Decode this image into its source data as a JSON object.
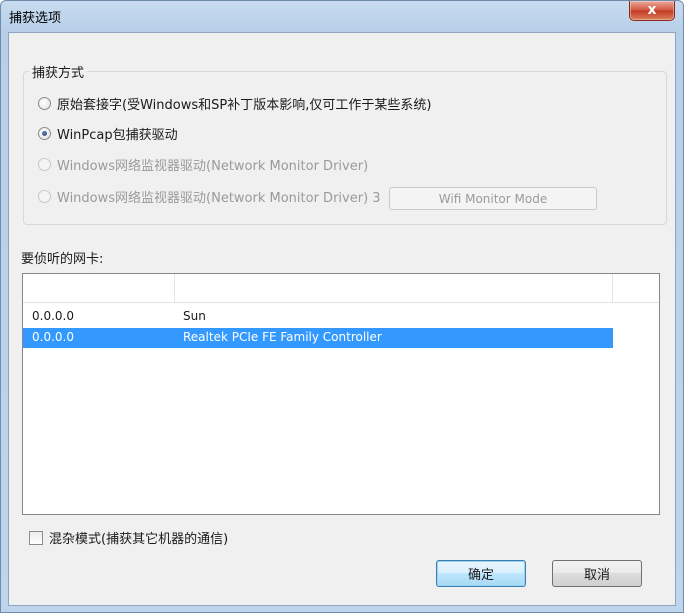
{
  "window": {
    "title": "捕获选项",
    "close_label": "x"
  },
  "capture_group": {
    "legend": "捕获方式",
    "options": [
      {
        "label": "原始套接字(受Windows和SP补丁版本影响,仅可工作于某些系统)",
        "checked": false,
        "enabled": true
      },
      {
        "label": "WinPcap包捕获驱动",
        "checked": true,
        "enabled": true
      },
      {
        "label": "Windows网络监视器驱动(Network Monitor Driver)",
        "checked": false,
        "enabled": false
      },
      {
        "label": "Windows网络监视器驱动(Network Monitor Driver) 3",
        "checked": false,
        "enabled": false
      }
    ],
    "wifi_button_label": "Wifi Monitor Mode"
  },
  "nic_section": {
    "label": "要侦听的网卡:",
    "rows": [
      {
        "ip": "0.0.0.0",
        "name": "Sun",
        "selected": false
      },
      {
        "ip": "0.0.0.0",
        "name": "Realtek PCIe FE Family Controller",
        "selected": true
      }
    ]
  },
  "promiscuous": {
    "label": "混杂模式(捕获其它机器的通信)",
    "checked": false
  },
  "buttons": {
    "ok_label": "确定",
    "cancel_label": "取消"
  }
}
